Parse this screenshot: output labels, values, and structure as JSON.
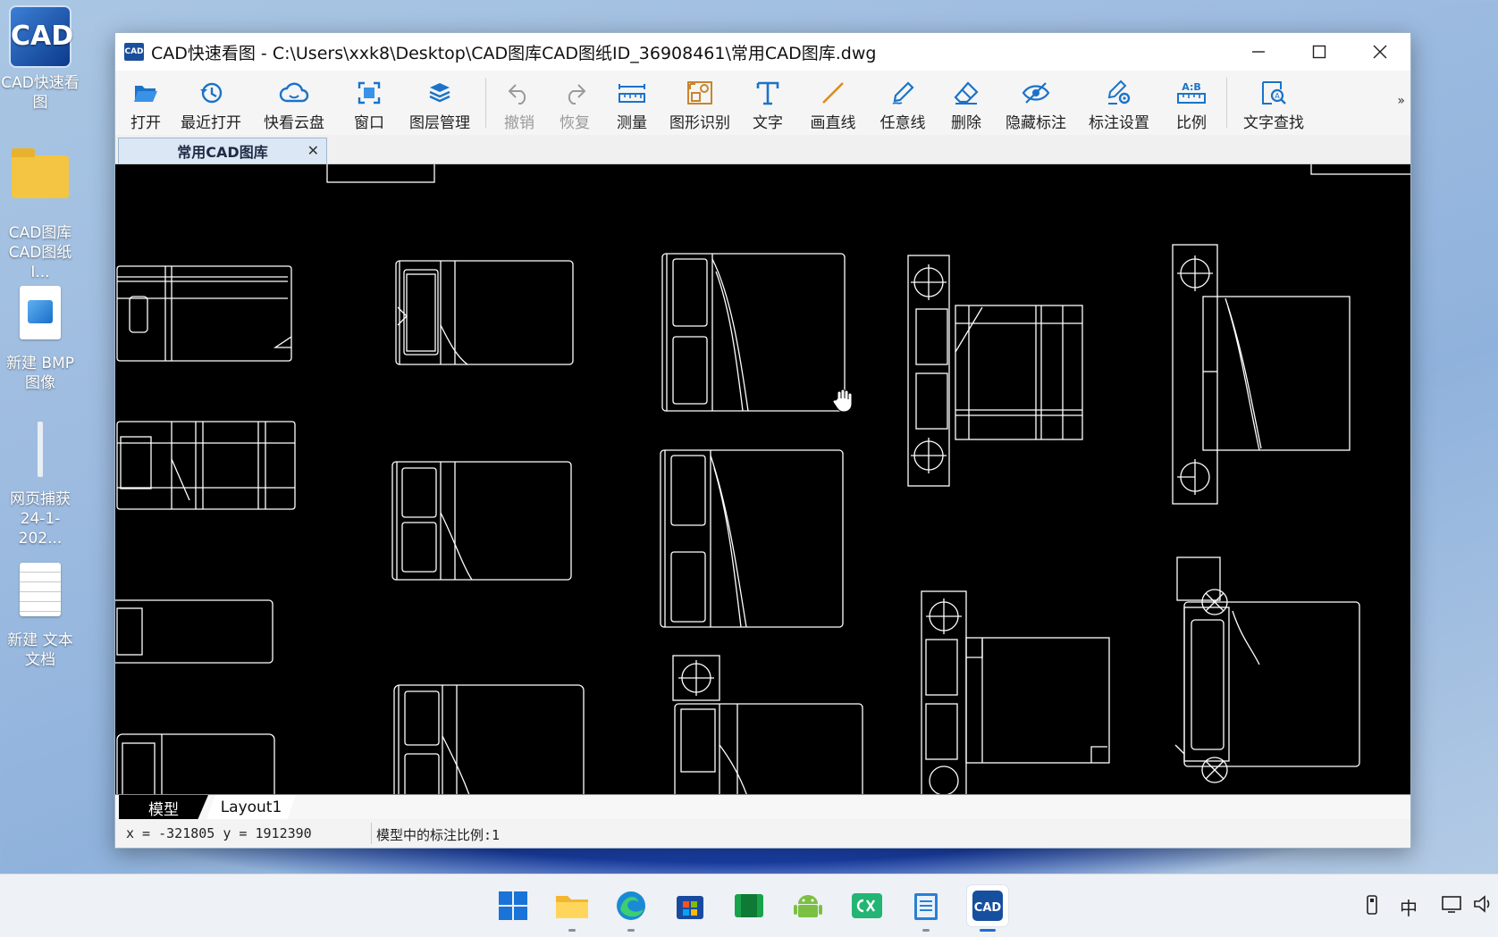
{
  "desktop": {
    "icons": [
      {
        "name": "CAD快速看图"
      },
      {
        "name": "CAD图库CAD图纸I..."
      },
      {
        "name": "新建 BMP 图像"
      },
      {
        "name": "网页捕获24-1-202..."
      },
      {
        "name": "新建 文本文档"
      }
    ]
  },
  "window": {
    "title": "CAD快速看图 - C:\\Users\\xxk8\\Desktop\\CAD图库CAD图纸ID_36908461\\常用CAD图库.dwg",
    "app_icon_text": "CAD"
  },
  "toolbar": {
    "items": [
      {
        "label": "打开",
        "icon": "folder-open-icon"
      },
      {
        "label": "最近打开",
        "icon": "history-icon"
      },
      {
        "label": "快看云盘",
        "icon": "cloud-icon"
      },
      {
        "label": "窗口",
        "icon": "window-zoom-icon"
      },
      {
        "label": "图层管理",
        "icon": "layers-icon"
      },
      {
        "label": "撤销",
        "icon": "undo-icon"
      },
      {
        "label": "恢复",
        "icon": "redo-icon"
      },
      {
        "label": "测量",
        "icon": "ruler-icon"
      },
      {
        "label": "图形识别",
        "icon": "shape-recognition-icon"
      },
      {
        "label": "文字",
        "icon": "text-icon"
      },
      {
        "label": "画直线",
        "icon": "line-icon"
      },
      {
        "label": "任意线",
        "icon": "pen-icon"
      },
      {
        "label": "删除",
        "icon": "eraser-icon"
      },
      {
        "label": "隐藏标注",
        "icon": "eye-hide-icon"
      },
      {
        "label": "标注设置",
        "icon": "annotation-settings-icon"
      },
      {
        "label": "比例",
        "icon": "scale-icon"
      },
      {
        "label": "文字查找",
        "icon": "text-search-icon"
      }
    ],
    "more": "»"
  },
  "tabs": {
    "document": "常用CAD图库",
    "close": "✕"
  },
  "layout_tabs": {
    "model": "模型",
    "layout": "Layout1"
  },
  "status": {
    "coordinates": "x = -321805 y = 1912390",
    "annotation_scale": "模型中的标注比例:1"
  },
  "taskbar": {
    "tray_ime": "中"
  },
  "colors": {
    "accent": "#1a73c9",
    "canvas_bg": "#000000",
    "cad_line": "#ffffff"
  }
}
